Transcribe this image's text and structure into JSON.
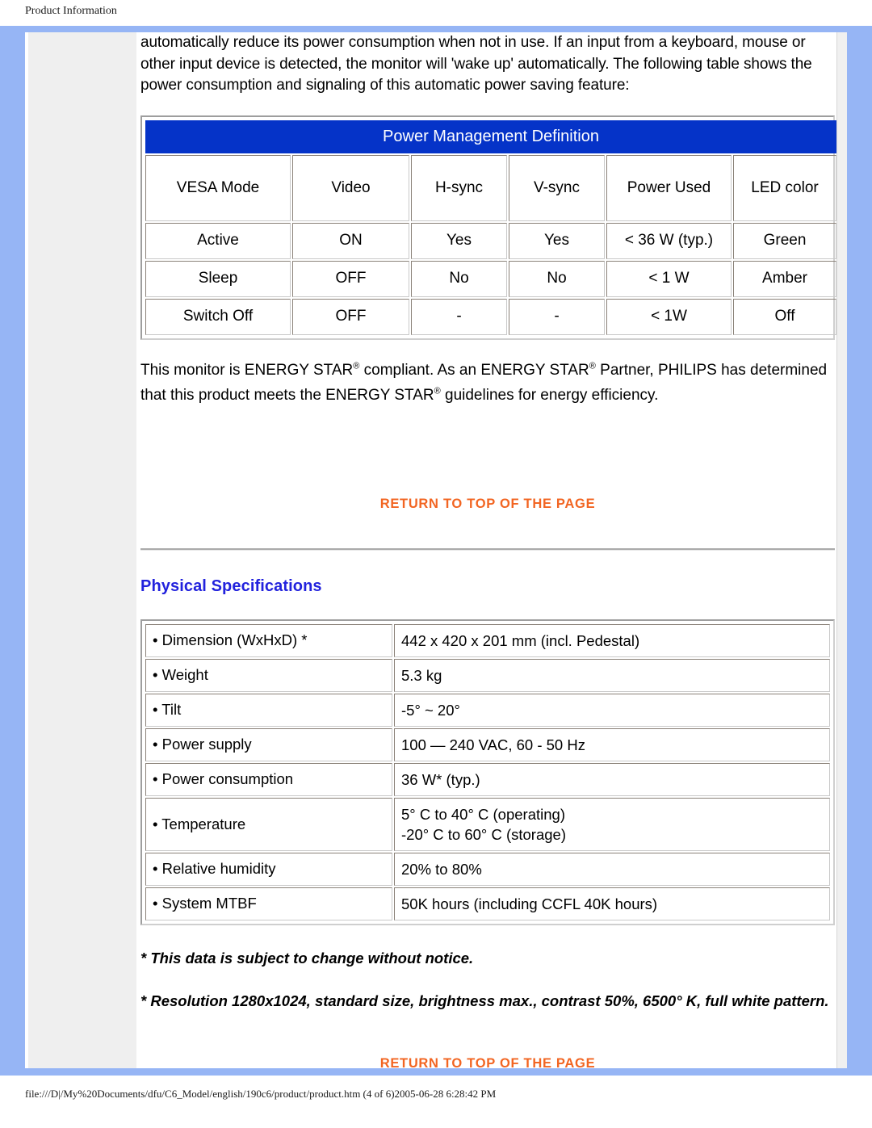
{
  "header": {
    "running_title": "Product Information"
  },
  "intro": {
    "paragraph": "automatically reduce its power consumption when not in use. If an input from a keyboard, mouse or other input device is detected, the monitor will 'wake up' automatically. The following table shows the power consumption and signaling of this automatic power saving feature:"
  },
  "power_management_table": {
    "title": "Power Management Definition",
    "columns": [
      "VESA Mode",
      "Video",
      "H-sync",
      "V-sync",
      "Power Used",
      "LED color"
    ],
    "rows": [
      [
        "Active",
        "ON",
        "Yes",
        "Yes",
        "< 36 W (typ.)",
        "Green"
      ],
      [
        "Sleep",
        "OFF",
        "No",
        "No",
        "< 1 W",
        "Amber"
      ],
      [
        "Switch Off",
        "OFF",
        "-",
        "-",
        "< 1W",
        "Off"
      ]
    ]
  },
  "energy_star": {
    "part1": "This monitor is ENERGY STAR",
    "part2": " compliant. As an ENERGY STAR",
    "part3": " Partner, PHILIPS has determined that this product meets the ENERGY STAR",
    "part4": " guidelines for energy efficiency.",
    "reg_symbol": "®"
  },
  "links": {
    "return_to_top": "RETURN TO TOP OF THE PAGE"
  },
  "physical_specifications": {
    "heading": "Physical Specifications",
    "rows": [
      {
        "label": "• Dimension (WxHxD) *",
        "value": [
          "442 x 420 x 201 mm (incl. Pedestal)"
        ]
      },
      {
        "label": "• Weight",
        "value": [
          "5.3 kg"
        ]
      },
      {
        "label": "• Tilt",
        "value": [
          "-5° ~ 20°"
        ]
      },
      {
        "label": "• Power supply",
        "value": [
          "100 — 240 VAC, 60 - 50 Hz"
        ]
      },
      {
        "label": "• Power consumption",
        "value": [
          "36 W* (typ.)"
        ]
      },
      {
        "label": "• Temperature",
        "value": [
          "5° C to 40° C (operating)",
          "-20° C to 60° C (storage)"
        ]
      },
      {
        "label": "• Relative humidity",
        "value": [
          "20% to 80%"
        ]
      },
      {
        "label": "• System MTBF",
        "value": [
          "50K hours (including CCFL 40K hours)"
        ]
      }
    ],
    "notes": [
      "* This data is subject to change without notice.",
      "* Resolution 1280x1024, standard size, brightness max., contrast 50%, 6500° K, full white pattern."
    ]
  },
  "footer": {
    "file_path": "file:///D|/My%20Documents/dfu/C6_Model/english/190c6/product/product.htm (4 of 6)2005-06-28 6:28:42 PM"
  },
  "colors": {
    "frame_blue": "#96b5f5",
    "table_header_blue": "#0533c8",
    "link_orange": "#f26522",
    "heading_blue": "#2222dd",
    "sidebar_gray": "#efefef"
  }
}
